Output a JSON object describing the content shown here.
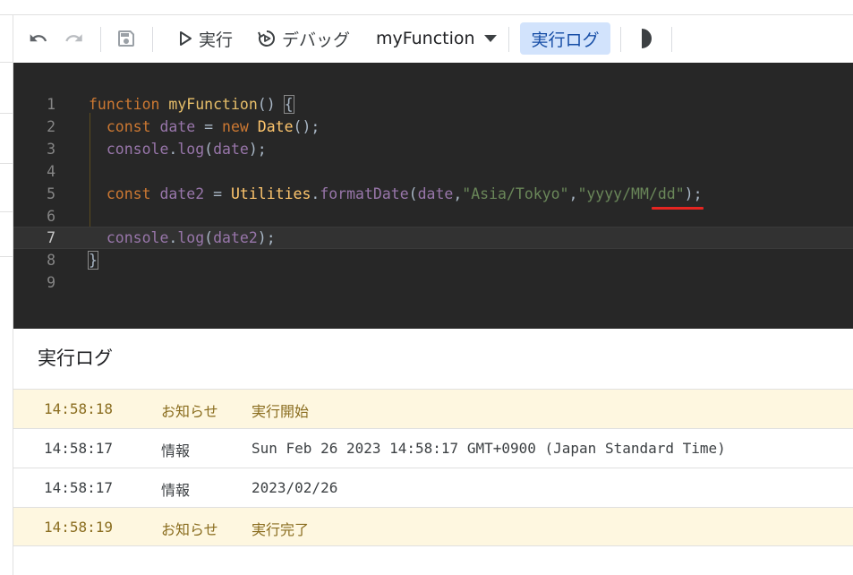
{
  "toolbar": {
    "run_label": "実行",
    "debug_label": "デバッグ",
    "function_name": "myFunction",
    "log_label": "実行ログ"
  },
  "editor": {
    "line_numbers": [
      "1",
      "2",
      "3",
      "4",
      "5",
      "6",
      "7",
      "8",
      "9"
    ],
    "active_line": 7,
    "lines": [
      [
        "function",
        " ",
        "myFunction",
        "() ",
        "{"
      ],
      [
        "  ",
        "const",
        " ",
        "date",
        " = ",
        "new",
        " ",
        "Date",
        "();"
      ],
      [
        "  ",
        "console",
        ".",
        "log",
        "(",
        "date",
        ");"
      ],
      [
        ""
      ],
      [
        "  ",
        "const",
        " ",
        "date2",
        " = ",
        "Utilities",
        ".",
        "formatDate",
        "(",
        "date",
        ",",
        "\"Asia/Tokyo\"",
        ",",
        "\"yyyy/MM/dd\"",
        ");"
      ],
      [
        ""
      ],
      [
        "  ",
        "console",
        ".",
        "log",
        "(",
        "date2",
        ");"
      ],
      [
        "}"
      ],
      [
        ""
      ]
    ]
  },
  "log_panel": {
    "title": "実行ログ",
    "entries": [
      {
        "time": "14:58:18",
        "level": "お知らせ",
        "message": "実行開始"
      },
      {
        "time": "14:58:17",
        "level": "情報",
        "message": "Sun Feb 26 2023 14:58:17 GMT+0900 (Japan Standard Time)"
      },
      {
        "time": "14:58:17",
        "level": "情報",
        "message": "2023/02/26"
      },
      {
        "time": "14:58:19",
        "level": "お知らせ",
        "message": "実行完了"
      }
    ]
  },
  "colors": {
    "editor_bg": "#272727",
    "keyword": "#cc7832",
    "function": "#e8bf6a",
    "variable": "#9876aa",
    "string": "#6a8759",
    "notice_bg": "#fef7e0",
    "log_button_bg": "#d2e3fc",
    "annotation_underline": "#e52521"
  },
  "icons": [
    "undo-icon",
    "redo-icon",
    "save-icon",
    "play-icon",
    "debug-icon",
    "dropdown-icon",
    "theme-toggle-icon"
  ]
}
